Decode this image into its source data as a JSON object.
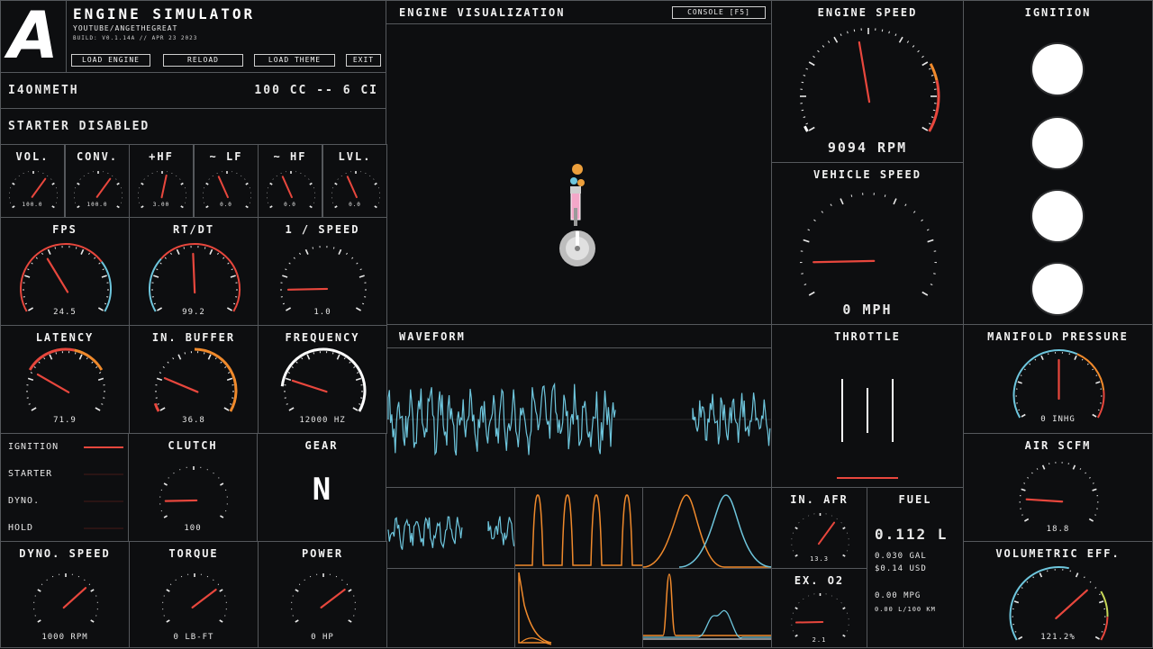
{
  "header": {
    "logo": "A",
    "title": "ENGINE SIMULATOR",
    "channel": "YOUTUBE/ANGETHEGREAT",
    "build": "BUILD: V0.1.14A // APR 23 2023",
    "buttons": [
      "LOAD ENGINE",
      "RELOAD",
      "LOAD THEME",
      "EXIT"
    ]
  },
  "engine_info": {
    "name": "I4ONMETH",
    "displacement": "100 CC -- 6 CI"
  },
  "starter_status": "STARTER DISABLED",
  "mixer": [
    {
      "label": "VOL.",
      "value": "100.0",
      "level": 0.65
    },
    {
      "label": "CONV.",
      "value": "100.0",
      "level": 0.65
    },
    {
      "label": "+HF",
      "value": "3.00",
      "level": 0.55
    },
    {
      "label": "~ LF",
      "value": "0.0",
      "level": 0.4
    },
    {
      "label": "~ HF",
      "value": "0.0",
      "level": 0.4
    },
    {
      "label": "LVL.",
      "value": "0.0",
      "level": 0.4
    }
  ],
  "perf": [
    {
      "label": "FPS",
      "value": "24.5",
      "level": 0.37
    },
    {
      "label": "RT/DT",
      "value": "99.2",
      "level": 0.49
    },
    {
      "label": "1 / SPEED",
      "value": "1.0",
      "level": 0.12
    }
  ],
  "audio": [
    {
      "label": "LATENCY",
      "value": "71.9",
      "level": 0.25
    },
    {
      "label": "IN. BUFFER",
      "value": "36.8",
      "level": 0.22
    },
    {
      "label": "FREQUENCY",
      "value": "12000 HZ",
      "level": 0.2
    }
  ],
  "controls": {
    "rows": [
      {
        "label": "IGNITION",
        "on": true
      },
      {
        "label": "STARTER",
        "on": false
      },
      {
        "label": "DYNO.",
        "on": false
      },
      {
        "label": "HOLD",
        "on": false
      }
    ],
    "clutch": {
      "label": "CLUTCH",
      "value": "100",
      "level": 0.12
    },
    "gear": {
      "label": "GEAR",
      "value": "N"
    }
  },
  "dyno": [
    {
      "label": "DYNO. SPEED",
      "value": "1000 RPM",
      "level": 0.7
    },
    {
      "label": "TORQUE",
      "value": "0 LB-FT",
      "level": 0.72
    },
    {
      "label": "POWER",
      "value": "0 HP",
      "level": 0.72
    }
  ],
  "visualization": {
    "title": "ENGINE VISUALIZATION",
    "console": "CONSOLE [F5]"
  },
  "waveform": {
    "title": "WAVEFORM"
  },
  "engine_speed": {
    "title": "ENGINE SPEED",
    "value": "9094 RPM",
    "level": 0.46
  },
  "vehicle_speed": {
    "title": "VEHICLE SPEED",
    "value": "0 MPH",
    "level": 0.12
  },
  "ignition_panel": {
    "title": "IGNITION"
  },
  "throttle": {
    "title": "THROTTLE"
  },
  "manifold": {
    "title": "MANIFOLD PRESSURE",
    "value": "0 INHG",
    "level": 0.5
  },
  "air": {
    "title": "AIR SCFM",
    "value": "18.8",
    "level": 0.14
  },
  "afr": {
    "title": "IN. AFR",
    "value": "13.3",
    "level": 0.65
  },
  "o2": {
    "title": "EX. O2",
    "value": "2.1",
    "level": 0.12
  },
  "fuel": {
    "title": "FUEL",
    "liters": "0.112 L",
    "gallons": "0.030 GAL",
    "cost": "$0.14 USD",
    "mpg": "0.00 MPG",
    "per100": "0.00 L/100 KM"
  },
  "volumetric": {
    "title": "VOLUMETRIC EFF.",
    "value": "121.2%",
    "level": 0.7
  },
  "colors": {
    "accent": "#e8473d",
    "blue": "#6ec6dd",
    "orange": "#f08a2c",
    "white": "#ffffff",
    "border": "#55585c"
  }
}
